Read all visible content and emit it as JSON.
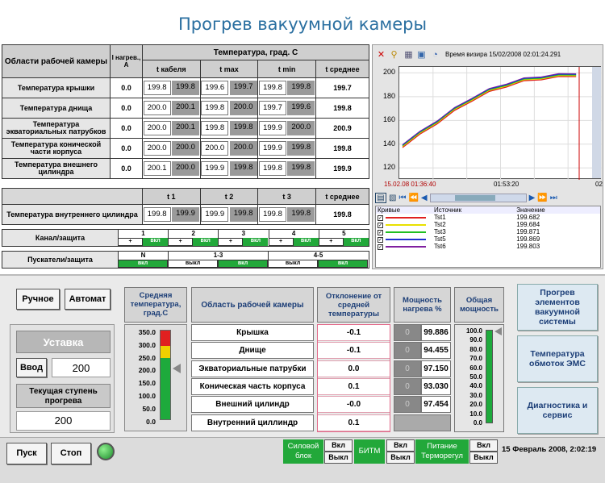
{
  "title": "Прогрев вакуумной камеры",
  "top_table": {
    "area_header": "Области рабочей камеры",
    "current_header": "I нагрев., А",
    "temp_header": "Температура, град. С",
    "sub": [
      "t кабеля",
      "t max",
      "t min",
      "t среднее"
    ],
    "rows": [
      {
        "label": "Температура крышки",
        "i": "0.0",
        "c1": "199.8",
        "c2": "199.8",
        "m1": "199.6",
        "m2": "199.7",
        "n1": "199.8",
        "n2": "199.8",
        "avg": "199.7"
      },
      {
        "label": "Температура днища",
        "i": "0.0",
        "c1": "200.0",
        "c2": "200.1",
        "m1": "199.8",
        "m2": "200.0",
        "n1": "199.7",
        "n2": "199.6",
        "avg": "199.8"
      },
      {
        "label": "Температура экваториальных патрубков",
        "i": "0.0",
        "c1": "200.0",
        "c2": "200.1",
        "m1": "199.8",
        "m2": "199.8",
        "n1": "199.9",
        "n2": "200.0",
        "avg": "200.9"
      },
      {
        "label": "Температура конической части корпуса",
        "i": "0.0",
        "c1": "200.0",
        "c2": "200.0",
        "m1": "200.0",
        "m2": "200.0",
        "n1": "199.9",
        "n2": "199.8",
        "avg": "199.8"
      },
      {
        "label": "Температура внешнего цилиндра",
        "i": "0.0",
        "c1": "200.1",
        "c2": "200.0",
        "m1": "199.9",
        "m2": "199.8",
        "n1": "199.8",
        "n2": "199.8",
        "avg": "199.9"
      }
    ],
    "sub2": [
      "t 1",
      "t 2",
      "t 3",
      "t среднее"
    ],
    "inner": {
      "label": "Температура внутреннего цилиндра",
      "c1": "199.8",
      "c2": "199.9",
      "m1": "199.9",
      "m2": "199.8",
      "n1": "199.8",
      "n2": "199.8",
      "avg": "199.8"
    },
    "channel_label": "Канал/защита",
    "channels": [
      "1",
      "2",
      "3",
      "4",
      "5"
    ],
    "plus": "+",
    "on": "вкл",
    "starters_label": "Пускатели/защита",
    "starters": [
      "N",
      "1-3",
      "4-5"
    ],
    "off": "выкл"
  },
  "chart": {
    "time_label": "Время визира 15/02/2008 02:01:24.291",
    "x_start": "15.02.08 01:36:40",
    "x_mid": "01:53:20",
    "x_end": "02",
    "legend_headers": [
      "Кривые",
      "Источник",
      "Значение"
    ],
    "legend": [
      {
        "name": "Tst1",
        "value": "199.682",
        "color": "#e02020"
      },
      {
        "name": "Tst2",
        "value": "199.684",
        "color": "#e8e000"
      },
      {
        "name": "Tst3",
        "value": "199.871",
        "color": "#20c020"
      },
      {
        "name": "Tst5",
        "value": "199.869",
        "color": "#2030d0"
      },
      {
        "name": "Tst6",
        "value": "199.803",
        "color": "#8020a0"
      }
    ]
  },
  "chart_data": {
    "type": "line",
    "ylim": [
      110,
      205
    ],
    "yticks": [
      "200",
      "180",
      "160",
      "140",
      "120"
    ],
    "x": [
      0,
      10,
      20,
      30,
      40,
      50,
      60,
      70,
      80,
      90,
      100
    ],
    "series": [
      {
        "name": "Tst1",
        "values": [
          140,
          150,
          160,
          170,
          179,
          186,
          191,
          195,
          197,
          198.5,
          199.7
        ]
      }
    ]
  },
  "controls": {
    "manual": "Ручное",
    "auto": "Автомат",
    "setpoint": "Уставка",
    "input": "Ввод",
    "input_value": "200",
    "stage": "Текущая ступень прогрева",
    "stage_value": "200",
    "start": "Пуск",
    "stop": "Стоп"
  },
  "gauge": {
    "header": "Средняя температура, град.С",
    "ticks": [
      "350.0",
      "300.0",
      "250.0",
      "200.0",
      "150.0",
      "100.0",
      "50.0",
      "0.0"
    ]
  },
  "zones": {
    "area_header": "Область рабочей камеры",
    "dev_header": "Отклонение от средней температуры",
    "power_header": "Мощность нагрева %",
    "total_header": "Общая мощность",
    "rows": [
      {
        "name": "Крышка",
        "dev": "-0.1",
        "power": "99.886"
      },
      {
        "name": "Днище",
        "dev": "-0.1",
        "power": "94.455"
      },
      {
        "name": "Экваториальные патрубки",
        "dev": "0.0",
        "power": "97.150"
      },
      {
        "name": "Коническая часть корпуса",
        "dev": "0.1",
        "power": "93.030"
      },
      {
        "name": "Внешний цилиндр",
        "dev": "-0.0",
        "power": "97.454"
      },
      {
        "name": "Внутренний циллиндр",
        "dev": "0.1",
        "power": ""
      }
    ],
    "power_marks": [
      "0",
      "0",
      "0",
      "0",
      "0"
    ],
    "total_ticks": [
      "100.0",
      "90.0",
      "80.0",
      "70.0",
      "60.0",
      "50.0",
      "40.0",
      "30.0",
      "20.0",
      "10.0",
      "0.0"
    ]
  },
  "side_buttons": [
    "Прогрев элементов вакуумной системы",
    "Температура обмоток ЭМС",
    "Диагностика и сервис"
  ],
  "status": {
    "power_block": "Силовой блок",
    "bitm": "БИТМ",
    "thermo": "Питание Терморегул",
    "on": "Вкл",
    "off": "Выкл",
    "datetime": "15 Февраль 2008, 2:02:19"
  }
}
